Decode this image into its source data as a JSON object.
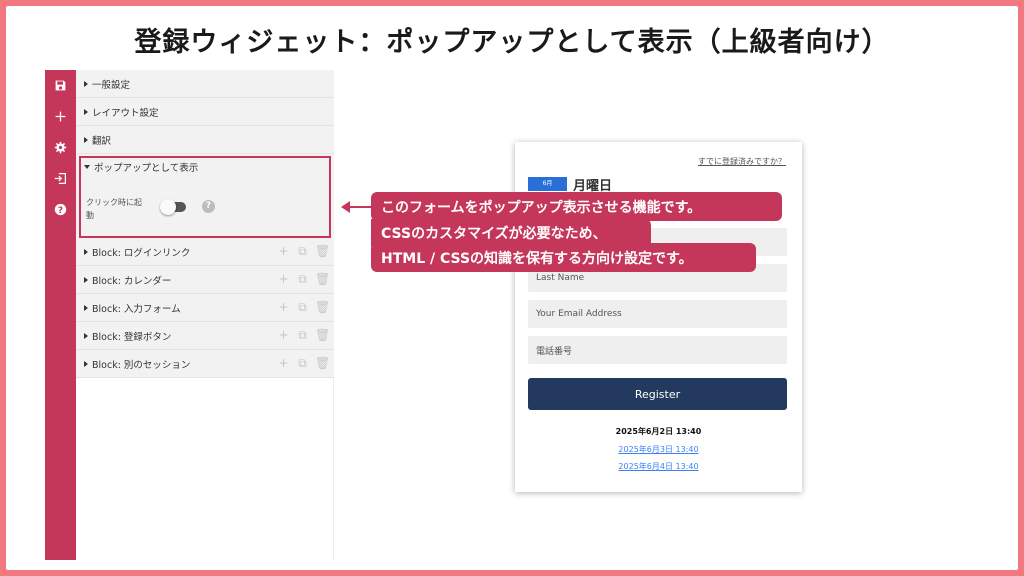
{
  "page_title": "登録ウィジェット：ポップアップとして表示（上級者向け）",
  "toolbar": [
    {
      "name": "save-icon",
      "symbol": "save"
    },
    {
      "name": "add-icon",
      "symbol": "+"
    },
    {
      "name": "gear-icon",
      "symbol": "gear"
    },
    {
      "name": "exit-icon",
      "symbol": "exit"
    },
    {
      "name": "help-icon",
      "symbol": "?"
    }
  ],
  "panel": {
    "general": "一般設定",
    "layout": "レイアウト設定",
    "translation": "翻訳",
    "popup": {
      "title": "ポップアップとして表示",
      "toggle_label": "クリック時に起動",
      "toggle_on": false,
      "help": "?"
    },
    "blocks": [
      "Block:  ログインリンク",
      "Block:  カレンダー",
      "Block:  入力フォーム",
      "Block:  登録ボタン",
      "Block:  別のセッション"
    ]
  },
  "callout": {
    "line1": "このフォームをポップアップ表示させる機能です。",
    "line2": "CSSのカスタマイズが必要なため、",
    "line3": "HTML / CSSの知識を保有する方向け設定です。"
  },
  "preview": {
    "login_link": "すでに登録済みですか？",
    "month": "6月",
    "weekday": "月曜日",
    "fields": {
      "last_name": "Last Name",
      "email": "Your Email Address",
      "phone": "電話番号"
    },
    "register": "Register",
    "sessions": {
      "current": "2025年6月2日 13:40",
      "others": [
        "2025年6月3日 13:40",
        "2025年6月4日 13:40"
      ]
    }
  },
  "colors": {
    "accent": "#c5375a",
    "border": "#f07880",
    "button": "#233a5e",
    "link": "#3b82f6"
  }
}
